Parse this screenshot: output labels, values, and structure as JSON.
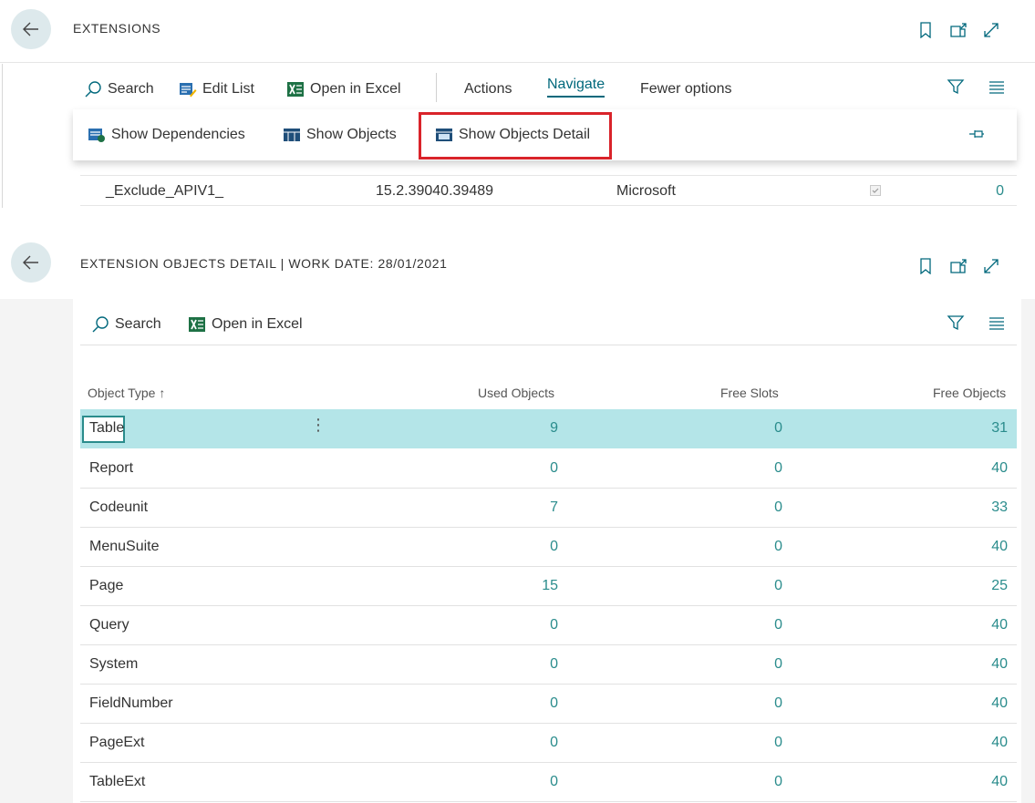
{
  "extensions_page": {
    "title": "EXTENSIONS",
    "toolbar": {
      "search": "Search",
      "edit_list": "Edit List",
      "open_in_excel": "Open in Excel",
      "actions": "Actions",
      "navigate": "Navigate",
      "fewer_options": "Fewer options"
    },
    "navigate_menu": {
      "show_dependencies": "Show Dependencies",
      "show_objects": "Show Objects",
      "show_objects_detail": "Show Objects Detail"
    },
    "row": {
      "name": "_Exclude_APIV1_",
      "version": "15.2.39040.39489",
      "publisher": "Microsoft",
      "ranges": "0"
    }
  },
  "detail_page": {
    "title": "EXTENSION OBJECTS DETAIL | WORK DATE: 28/01/2021",
    "toolbar": {
      "search": "Search",
      "open_in_excel": "Open in Excel"
    },
    "columns": {
      "object_type": "Object Type ↑",
      "used_objects": "Used Objects",
      "free_slots": "Free Slots",
      "free_objects": "Free Objects"
    },
    "rows": [
      {
        "type": "Table",
        "used": "9",
        "slots": "0",
        "free": "31"
      },
      {
        "type": "Report",
        "used": "0",
        "slots": "0",
        "free": "40"
      },
      {
        "type": "Codeunit",
        "used": "7",
        "slots": "0",
        "free": "33"
      },
      {
        "type": "MenuSuite",
        "used": "0",
        "slots": "0",
        "free": "40"
      },
      {
        "type": "Page",
        "used": "15",
        "slots": "0",
        "free": "25"
      },
      {
        "type": "Query",
        "used": "0",
        "slots": "0",
        "free": "40"
      },
      {
        "type": "System",
        "used": "0",
        "slots": "0",
        "free": "40"
      },
      {
        "type": "FieldNumber",
        "used": "0",
        "slots": "0",
        "free": "40"
      },
      {
        "type": "PageExt",
        "used": "0",
        "slots": "0",
        "free": "40"
      },
      {
        "type": "TableExt",
        "used": "0",
        "slots": "0",
        "free": "40"
      }
    ]
  },
  "colors": {
    "accent": "#00687c",
    "number_text": "#2a8c8c",
    "selected_row": "#b4e5e8",
    "highlight_border": "#d9232a",
    "excel_green": "#1e7145"
  },
  "icons": [
    "back-arrow-icon",
    "bookmark-icon",
    "open-new-window-icon",
    "expand-icon",
    "search-icon",
    "edit-list-icon",
    "excel-icon",
    "filter-icon",
    "list-view-icon",
    "dependencies-icon",
    "objects-icon",
    "objects-detail-icon",
    "pin-icon",
    "more-options-icon"
  ]
}
